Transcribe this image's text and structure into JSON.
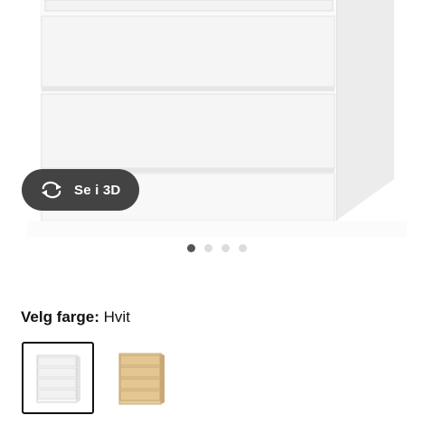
{
  "viewer": {
    "btn3d_label": "Se i 3D",
    "btn3d_icon": "rotate-3d-icon",
    "carousel_count": 4,
    "carousel_active": 0
  },
  "colour": {
    "label": "Velg farge:",
    "value": "Hvit"
  },
  "variants": [
    {
      "colour": "#ffffff",
      "selected": true
    },
    {
      "colour": "#e3c99c",
      "selected": false
    }
  ],
  "colors": {
    "pill": "#434343",
    "dot_active": "#555555",
    "dot_inactive": "#dcdcdc"
  }
}
